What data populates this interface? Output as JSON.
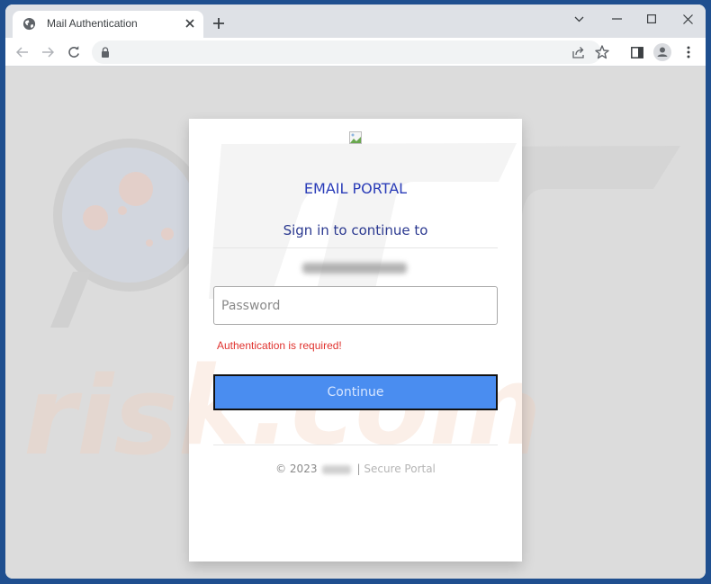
{
  "browser": {
    "tab": {
      "title": "Mail Authentication",
      "favicon": "globe-icon"
    },
    "new_tab_label": "+",
    "window_controls": [
      "tab-search",
      "minimize",
      "maximize",
      "close"
    ],
    "address_bar": {
      "url": "",
      "security_icon": "lock-icon"
    },
    "toolbar_icons": [
      "share-icon",
      "bookmark-star-icon",
      "side-panel-icon",
      "profile-avatar-icon",
      "kebab-menu-icon"
    ]
  },
  "page": {
    "logo_alt": "",
    "title": "EMAIL PORTAL",
    "subtitle": "Sign in to continue to",
    "email_display": "[blurred email address]",
    "password_field": {
      "value": "",
      "placeholder": "Password"
    },
    "error_message": "Authentication is required!",
    "continue_label": "Continue",
    "footer": {
      "copyright": "© 2023",
      "organization": "[blurred]",
      "separator": "|",
      "tagline": "Secure Portal"
    }
  },
  "colors": {
    "title": "#2a3cb8",
    "subtitle": "#2b3990",
    "error": "#e0322e",
    "button": "#4a8df0",
    "page_bg": "#dcdcdc",
    "frame": "#1f4f8f"
  }
}
